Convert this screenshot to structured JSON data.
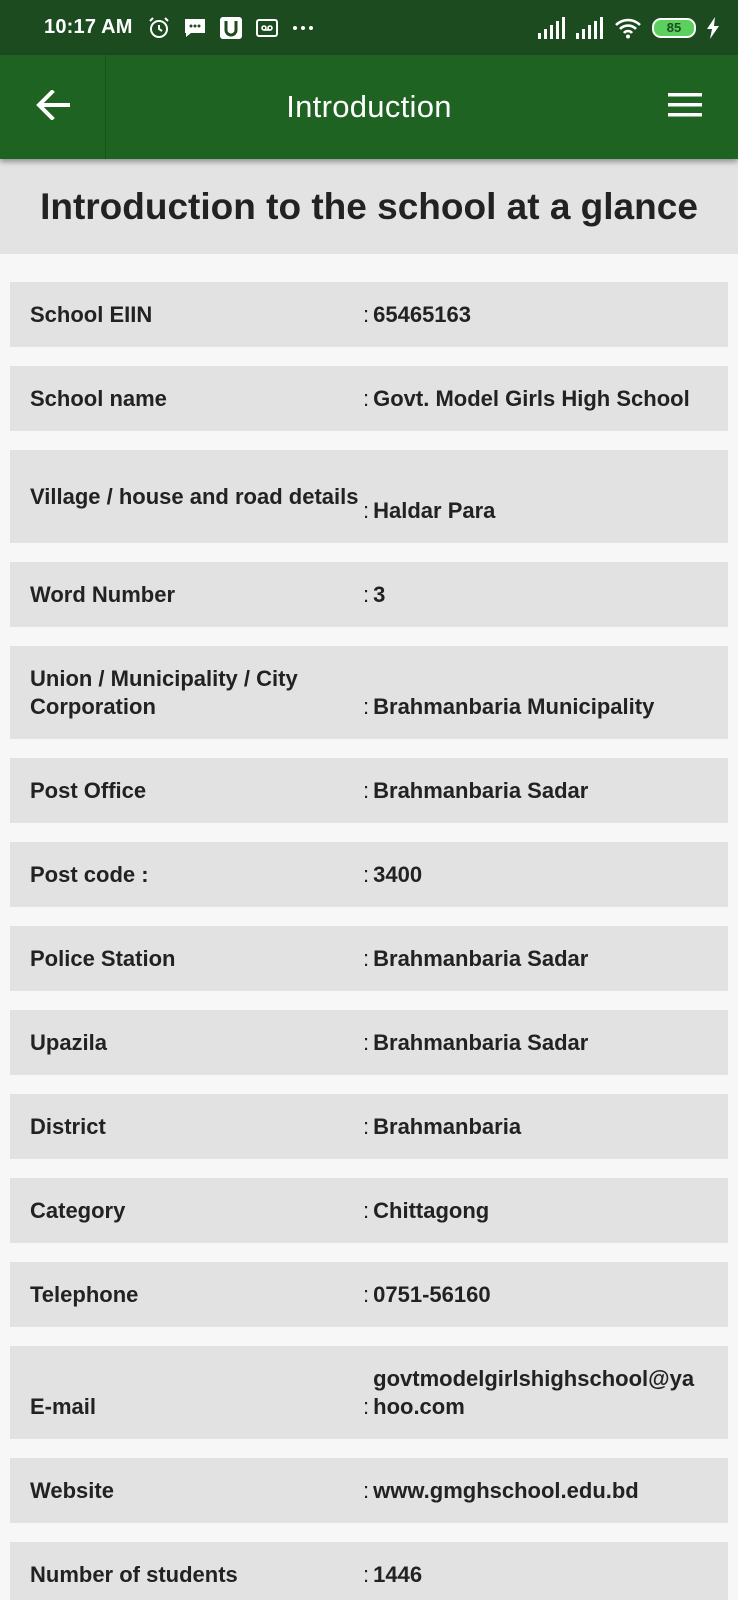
{
  "status_bar": {
    "time": "10:17 AM",
    "battery": "85"
  },
  "app_bar": {
    "title": "Introduction"
  },
  "page": {
    "heading": "Introduction to the school at a glance"
  },
  "rows": [
    {
      "label": "School EIIN",
      "value": "65465163"
    },
    {
      "label": "School name",
      "value": "Govt. Model Girls High School"
    },
    {
      "label": "Village / house and road details",
      "value": "Haldar Para"
    },
    {
      "label": "Word Number",
      "value": "3"
    },
    {
      "label": "Union / Municipality / City Corporation",
      "value": "Brahmanbaria Municipality"
    },
    {
      "label": "Post Office",
      "value": "Brahmanbaria Sadar"
    },
    {
      "label": "Post code :",
      "value": "3400"
    },
    {
      "label": "Police Station",
      "value": "Brahmanbaria Sadar"
    },
    {
      "label": "Upazila",
      "value": "Brahmanbaria Sadar"
    },
    {
      "label": "District",
      "value": "Brahmanbaria"
    },
    {
      "label": "Category",
      "value": "Chittagong"
    },
    {
      "label": "Telephone",
      "value": "0751-56160"
    },
    {
      "label": "E-mail",
      "value": "govtmodelgirlshighschool@yahoo.com"
    },
    {
      "label": "Website",
      "value": "www.gmghschool.edu.bd"
    },
    {
      "label": "Number of students",
      "value": "1446"
    }
  ],
  "colors": {
    "status_bar": "#1b4b1f",
    "app_bar": "#1f6322",
    "row_bg": "#e2e2e2",
    "heading_bg": "#e3e3e3"
  }
}
